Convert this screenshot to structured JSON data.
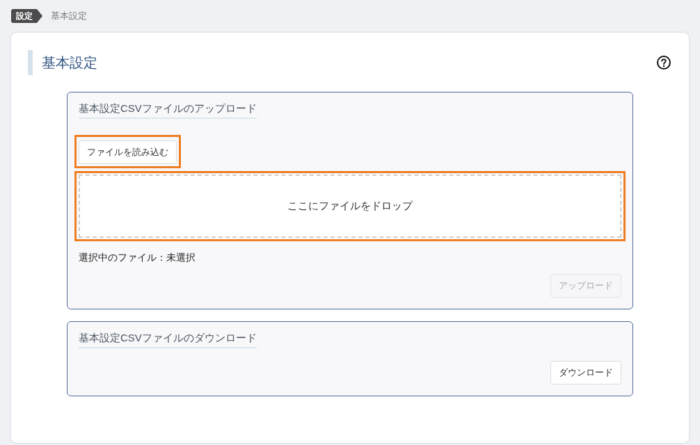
{
  "breadcrumb": [
    {
      "label": "設定",
      "current": false
    },
    {
      "label": "基本設定",
      "current": true
    }
  ],
  "page": {
    "title": "基本設定"
  },
  "sections": [
    {
      "kind": "upload",
      "title": "基本設定CSVファイルのアップロード",
      "file_button": {
        "label": "ファイルを読み込む",
        "highlighted": true
      },
      "drop_zone": {
        "label": "ここにファイルをドロップ",
        "highlighted": true
      },
      "selected_file": {
        "label": "選択中のファイル：",
        "value": "未選択"
      },
      "action": {
        "label": "アップロード",
        "disabled": true
      }
    },
    {
      "kind": "download",
      "title": "基本設定CSVファイルのダウンロード",
      "action": {
        "label": "ダウンロード",
        "disabled": false
      }
    }
  ]
}
